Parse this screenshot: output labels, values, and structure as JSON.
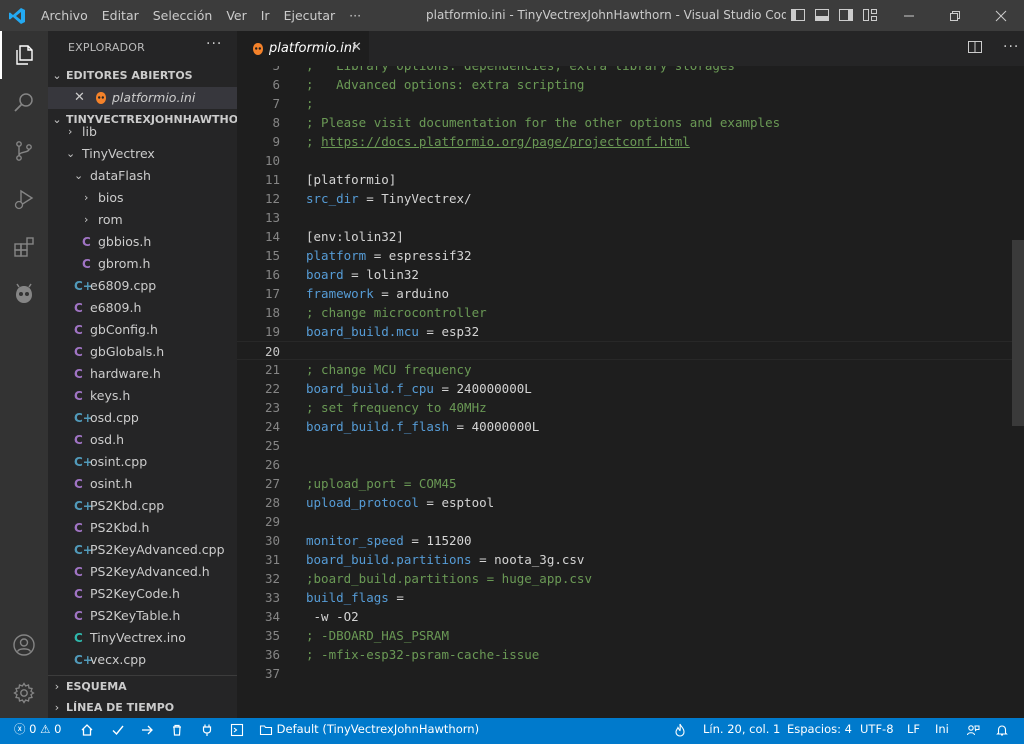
{
  "titlebar": {
    "menus": [
      "Archivo",
      "Editar",
      "Selección",
      "Ver",
      "Ir",
      "Ejecutar"
    ],
    "more": "···",
    "title": "platformio.ini - TinyVectrexJohnHawthorn - Visual Studio Code [A..."
  },
  "sidebar": {
    "title": "EXPLORADOR",
    "more": "···",
    "open_editors_label": "EDITORES ABIERTOS",
    "open_editor_file": "platformio.ini",
    "workspace_label": "TINYVECTREXJOHNHAWTHORN",
    "tree": [
      {
        "label": "lib",
        "type": "folder-collapsed"
      },
      {
        "label": "TinyVectrex",
        "type": "folder-open"
      },
      {
        "label": "dataFlash",
        "type": "folder-open"
      },
      {
        "label": "bios",
        "type": "folder-collapsed"
      },
      {
        "label": "rom",
        "type": "folder-collapsed"
      },
      {
        "label": "gbbios.h",
        "type": "c"
      },
      {
        "label": "gbrom.h",
        "type": "c"
      },
      {
        "label": "e6809.cpp",
        "type": "cpp"
      },
      {
        "label": "e6809.h",
        "type": "c"
      },
      {
        "label": "gbConfig.h",
        "type": "c"
      },
      {
        "label": "gbGlobals.h",
        "type": "c"
      },
      {
        "label": "hardware.h",
        "type": "c"
      },
      {
        "label": "keys.h",
        "type": "c"
      },
      {
        "label": "osd.cpp",
        "type": "cpp"
      },
      {
        "label": "osd.h",
        "type": "c"
      },
      {
        "label": "osint.cpp",
        "type": "cpp"
      },
      {
        "label": "osint.h",
        "type": "c"
      },
      {
        "label": "PS2Kbd.cpp",
        "type": "cpp"
      },
      {
        "label": "PS2Kbd.h",
        "type": "c"
      },
      {
        "label": "PS2KeyAdvanced.cpp",
        "type": "cpp"
      },
      {
        "label": "PS2KeyAdvanced.h",
        "type": "c"
      },
      {
        "label": "PS2KeyCode.h",
        "type": "c"
      },
      {
        "label": "PS2KeyTable.h",
        "type": "c"
      },
      {
        "label": "TinyVectrex.ino",
        "type": "ino"
      },
      {
        "label": "vecx.cpp",
        "type": "cpp"
      }
    ],
    "outline_label": "ESQUEMA",
    "timeline_label": "LÍNEA DE TIEMPO"
  },
  "editor": {
    "tab_label": "platformio.ini",
    "current_line": 20,
    "lines": [
      {
        "n": "5",
        "tokens": [
          {
            "t": ";   Library options: dependencies, extra library storages",
            "c": "comment"
          }
        ]
      },
      {
        "n": "6",
        "tokens": [
          {
            "t": ";   Advanced options: extra scripting",
            "c": "comment"
          }
        ]
      },
      {
        "n": "7",
        "tokens": [
          {
            "t": ";",
            "c": "comment"
          }
        ]
      },
      {
        "n": "8",
        "tokens": [
          {
            "t": "; Please visit documentation for the other options and examples",
            "c": "comment"
          }
        ]
      },
      {
        "n": "9",
        "tokens": [
          {
            "t": "; ",
            "c": "comment"
          },
          {
            "t": "https://docs.platformio.org/page/projectconf.html",
            "c": "link"
          }
        ]
      },
      {
        "n": "10",
        "tokens": []
      },
      {
        "n": "11",
        "tokens": [
          {
            "t": "[platformio]",
            "c": "plain"
          }
        ]
      },
      {
        "n": "12",
        "tokens": [
          {
            "t": "src_dir",
            "c": "key"
          },
          {
            "t": " = TinyVectrex/",
            "c": "plain"
          }
        ]
      },
      {
        "n": "13",
        "tokens": []
      },
      {
        "n": "14",
        "tokens": [
          {
            "t": "[env:lolin32]",
            "c": "plain"
          }
        ]
      },
      {
        "n": "15",
        "tokens": [
          {
            "t": "platform",
            "c": "key"
          },
          {
            "t": " = espressif32",
            "c": "plain"
          }
        ]
      },
      {
        "n": "16",
        "tokens": [
          {
            "t": "board",
            "c": "key"
          },
          {
            "t": " = lolin32",
            "c": "plain"
          }
        ]
      },
      {
        "n": "17",
        "tokens": [
          {
            "t": "framework",
            "c": "key"
          },
          {
            "t": " = arduino",
            "c": "plain"
          }
        ]
      },
      {
        "n": "18",
        "tokens": [
          {
            "t": "; change microcontroller",
            "c": "comment"
          }
        ]
      },
      {
        "n": "19",
        "tokens": [
          {
            "t": "board_build.mcu",
            "c": "key"
          },
          {
            "t": " = esp32",
            "c": "plain"
          }
        ]
      },
      {
        "n": "20",
        "tokens": []
      },
      {
        "n": "21",
        "tokens": [
          {
            "t": "; change MCU frequency",
            "c": "comment"
          }
        ]
      },
      {
        "n": "22",
        "tokens": [
          {
            "t": "board_build.f_cpu",
            "c": "key"
          },
          {
            "t": " = 240000000L",
            "c": "plain"
          }
        ]
      },
      {
        "n": "23",
        "tokens": [
          {
            "t": "; set frequency to 40MHz",
            "c": "comment"
          }
        ]
      },
      {
        "n": "24",
        "tokens": [
          {
            "t": "board_build.f_flash",
            "c": "key"
          },
          {
            "t": " = 40000000L",
            "c": "plain"
          }
        ]
      },
      {
        "n": "25",
        "tokens": []
      },
      {
        "n": "26",
        "tokens": []
      },
      {
        "n": "27",
        "tokens": [
          {
            "t": ";upload_port = COM45",
            "c": "comment"
          }
        ]
      },
      {
        "n": "28",
        "tokens": [
          {
            "t": "upload_protocol",
            "c": "key"
          },
          {
            "t": " = esptool",
            "c": "plain"
          }
        ]
      },
      {
        "n": "29",
        "tokens": []
      },
      {
        "n": "30",
        "tokens": [
          {
            "t": "monitor_speed",
            "c": "key"
          },
          {
            "t": " = 115200",
            "c": "plain"
          }
        ]
      },
      {
        "n": "31",
        "tokens": [
          {
            "t": "board_build.partitions",
            "c": "key"
          },
          {
            "t": " = noota_3g.csv",
            "c": "plain"
          }
        ]
      },
      {
        "n": "32",
        "tokens": [
          {
            "t": ";board_build.partitions = huge_app.csv",
            "c": "comment"
          }
        ]
      },
      {
        "n": "33",
        "tokens": [
          {
            "t": "build_flags",
            "c": "key"
          },
          {
            "t": " =",
            "c": "plain"
          }
        ]
      },
      {
        "n": "34",
        "tokens": [
          {
            "t": " -w -O2",
            "c": "plain"
          }
        ]
      },
      {
        "n": "35",
        "tokens": [
          {
            "t": "; -DBOARD_HAS_PSRAM",
            "c": "comment"
          }
        ]
      },
      {
        "n": "36",
        "tokens": [
          {
            "t": "; -mfix-esp32-psram-cache-issue",
            "c": "comment"
          }
        ]
      },
      {
        "n": "37",
        "tokens": []
      }
    ]
  },
  "statusbar": {
    "errors": "0",
    "warnings": "0",
    "env": "Default (TinyVectrexJohnHawthorn)",
    "position": "Lín. 20, col. 1",
    "spaces": "Espacios: 4",
    "encoding": "UTF-8",
    "eol": "LF",
    "language": "Ini"
  },
  "colors": {
    "statusbar": "#007acc",
    "activitybar": "#333333",
    "sidebar": "#252526",
    "editor": "#1e1e1e",
    "titlebar": "#3c3c3c",
    "comment": "#6a9955",
    "key": "#569cd6"
  }
}
